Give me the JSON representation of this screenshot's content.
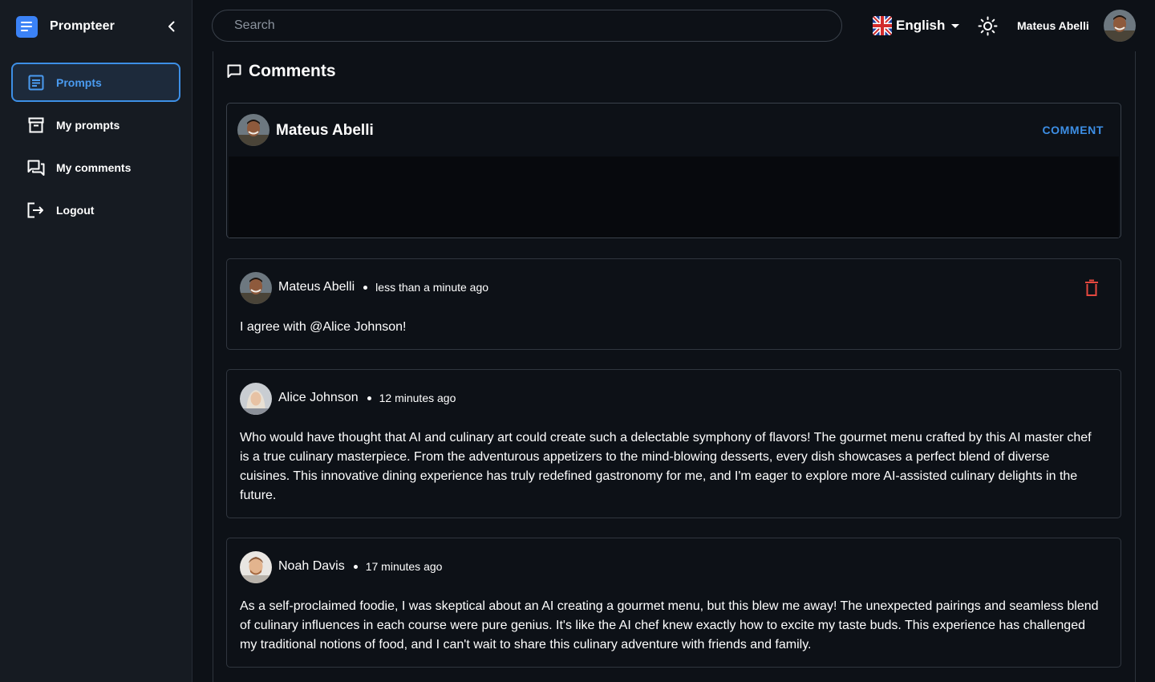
{
  "app": {
    "name": "Prompteer",
    "brand_color": "#3b82f6"
  },
  "sidebar": {
    "items": [
      {
        "label": "Prompts",
        "icon": "prompt-list-icon",
        "active": true
      },
      {
        "label": "My prompts",
        "icon": "archive-icon",
        "active": false
      },
      {
        "label": "My comments",
        "icon": "forum-icon",
        "active": false
      },
      {
        "label": "Logout",
        "icon": "logout-icon",
        "active": false
      }
    ]
  },
  "header": {
    "search_placeholder": "Search",
    "language": "English",
    "language_icon": "uk-flag-icon",
    "theme_icon": "sun-icon",
    "user_name": "Mateus Abelli"
  },
  "comments_section": {
    "title": "Comments",
    "composer": {
      "author": "Mateus Abelli",
      "submit_label": "COMMENT",
      "value": ""
    },
    "items": [
      {
        "author": "Mateus Abelli",
        "time": "less than a minute ago",
        "text": "I agree with @Alice Johnson!",
        "can_delete": true
      },
      {
        "author": "Alice Johnson",
        "time": "12 minutes ago",
        "text": "Who would have thought that AI and culinary art could create such a delectable symphony of flavors! The gourmet menu crafted by this AI master chef is a true culinary masterpiece. From the adventurous appetizers to the mind-blowing desserts, every dish showcases a perfect blend of diverse cuisines. This innovative dining experience has truly redefined gastronomy for me, and I'm eager to explore more AI-assisted culinary delights in the future.",
        "can_delete": false
      },
      {
        "author": "Noah Davis",
        "time": "17 minutes ago",
        "text": "As a self-proclaimed foodie, I was skeptical about an AI creating a gourmet menu, but this blew me away! The unexpected pairings and seamless blend of culinary influences in each course were pure genius. It's like the AI chef knew exactly how to excite my taste buds. This experience has challenged my traditional notions of food, and I can't wait to share this culinary adventure with friends and family.",
        "can_delete": false
      }
    ]
  },
  "colors": {
    "accent": "#3d8fe6",
    "delete": "#e5483f",
    "background": "#0d1117",
    "sidebar": "#161b22"
  }
}
